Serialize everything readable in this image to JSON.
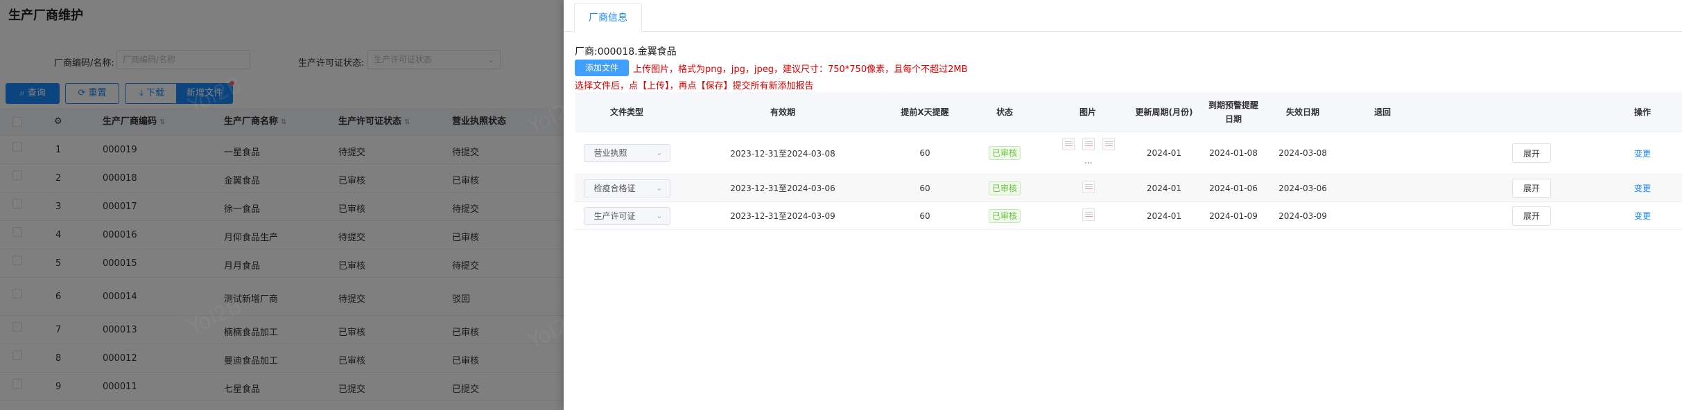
{
  "background": {
    "title": "生产厂商维护",
    "filters": {
      "code_name_label": "厂商编码/名称:",
      "code_name_placeholder": "厂商编码/名称",
      "license_label": "生产许可证状态:",
      "license_placeholder": "生产许可证状态"
    },
    "buttons": {
      "search": "查询",
      "reset": "重置",
      "download": "下载",
      "new_file": "新增文件"
    },
    "columns": {
      "code": "生产厂商编码",
      "name": "生产厂商名称",
      "license_status": "生产许可证状态",
      "business_status": "营业执照状态"
    },
    "rows": [
      {
        "index": "1",
        "code": "000019",
        "name": "一星食品",
        "license": "待提交",
        "business": "待提交"
      },
      {
        "index": "2",
        "code": "000018",
        "name": "金翼食品",
        "license": "已审核",
        "business": "已审核"
      },
      {
        "index": "3",
        "code": "000017",
        "name": "徐一食品",
        "license": "已审核",
        "business": "待提交"
      },
      {
        "index": "4",
        "code": "000016",
        "name": "月仰食品生产",
        "license": "待提交",
        "business": "已审核"
      },
      {
        "index": "5",
        "code": "000015",
        "name": "月月食品",
        "license": "已审核",
        "business": "待提交"
      },
      {
        "index": "6",
        "code": "000014",
        "name": "测试新增厂商",
        "license": "待提交",
        "business": "驳回"
      },
      {
        "index": "7",
        "code": "000013",
        "name": "楠楠食品加工",
        "license": "已审核",
        "business": "已审核"
      },
      {
        "index": "8",
        "code": "000012",
        "name": "曼迪食品加工",
        "license": "已审核",
        "business": "已审核"
      },
      {
        "index": "9",
        "code": "000011",
        "name": "七星食品",
        "license": "已提交",
        "business": "已提交"
      }
    ]
  },
  "drawer": {
    "tab": "厂商信息",
    "vendor_line": "厂商:000018.金翼食品",
    "add_file_button": "添加文件",
    "hint_upload": "上传图片，格式为png，jpg，jpeg，建议尺寸：750*750像素，且每个不超过2MB",
    "hint_submit": "选择文件后，点【上传】，再点【保存】提交所有新添加报告",
    "columns": {
      "file_type": "文件类型",
      "validity": "有效期",
      "remind_days": "提前X天提醒",
      "status": "状态",
      "image": "图片",
      "cycle": "更新周期(月份)",
      "warn_date": "到期预警提醒日期",
      "expiry": "失效日期",
      "rollback": "退回",
      "action": "操作"
    },
    "rows": [
      {
        "type": "营业执照",
        "validity": "2023-12-31至2024-03-08",
        "remind": "60",
        "status": "已审核",
        "cycle": "2024-01",
        "warn": "2024-01-08",
        "expiry": "2024-03-08",
        "expand": "展开",
        "change": "变更"
      },
      {
        "type": "检疫合格证",
        "validity": "2023-12-31至2024-03-06",
        "remind": "60",
        "status": "已审核",
        "cycle": "2024-01",
        "warn": "2024-01-06",
        "expiry": "2024-03-06",
        "expand": "展开",
        "change": "变更"
      },
      {
        "type": "生产许可证",
        "validity": "2023-12-31至2024-03-09",
        "remind": "60",
        "status": "已审核",
        "cycle": "2024-01",
        "warn": "2024-01-09",
        "expiry": "2024-03-09",
        "expand": "展开",
        "change": "变更"
      }
    ],
    "more_images": "..."
  },
  "watermark": "Yol2B"
}
